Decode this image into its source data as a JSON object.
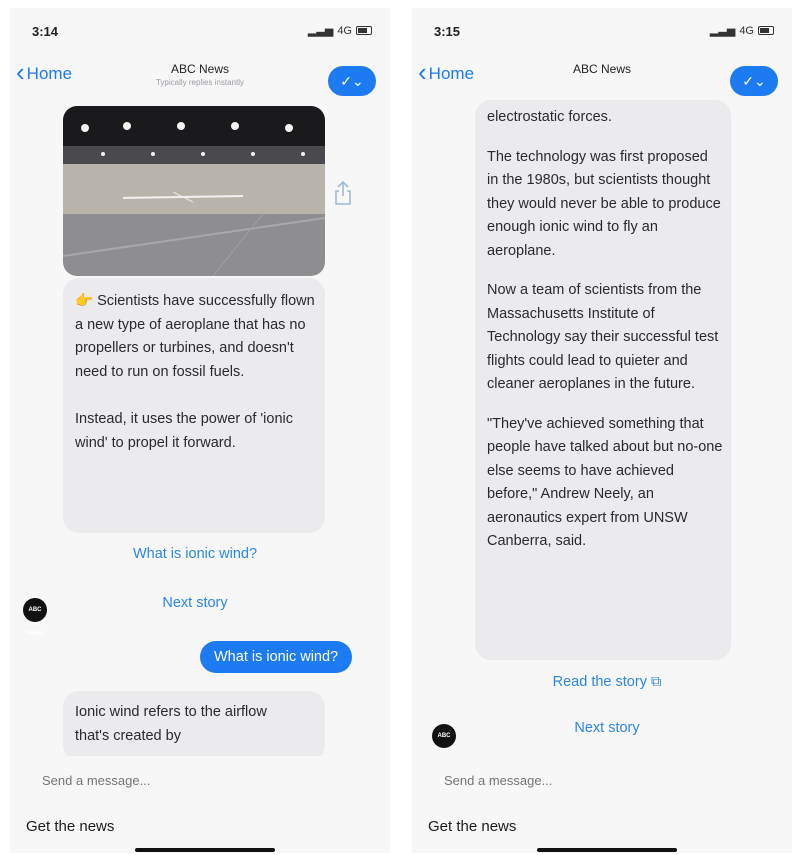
{
  "left": {
    "status_time": "3:14",
    "status_network": "4G",
    "nav": {
      "back_label": "Home",
      "title": "ABC News",
      "subtitle": "Typically replies instantly",
      "action_icon": "check-chevron-icon"
    },
    "image_alt": "Aircraft in an indoor hangar",
    "message_lead_emoji": "👉",
    "message_paragraphs": [
      "Scientists have successfully flown a new type of aeroplane that has no propellers or turbines, and doesn't need to run on fossil fuels.",
      "Instead, it uses the power of 'ionic wind' to propel it forward."
    ],
    "quick_replies": [
      "What is ionic wind?",
      "Next story"
    ],
    "user_message": "What is ionic wind?",
    "reply_partial": "Ionic wind refers to the airflow that's created by",
    "avatar_label": "ABC NEWS",
    "composer_placeholder": "Send a message...",
    "bottom_label": "Get the news"
  },
  "right": {
    "status_time": "3:15",
    "status_network": "4G",
    "nav": {
      "back_label": "Home",
      "title": "ABC News",
      "subtitle": "",
      "action_icon": "check-chevron-icon"
    },
    "message_paragraphs": [
      "electrostatic forces.",
      "The technology was first proposed in the 1980s, but scientists thought they would never be able to produce enough ionic wind to fly an aeroplane.",
      "Now a team of scientists from the Massachusetts Institute of Technology say their successful test flights could lead to quieter and cleaner aeroplanes in the future.",
      "\"They've achieved something that people have talked about but no-one else seems to have achieved before,\" Andrew Neely, an aeronautics expert from UNSW Canberra, said."
    ],
    "quick_replies": [
      "Read the story",
      "Next story"
    ],
    "avatar_label": "ABC NEWS",
    "composer_placeholder": "Send a message...",
    "bottom_label": "Get the news"
  },
  "colors": {
    "accent": "#1d7bf2",
    "link": "#2b86ea",
    "bubble": "#ebebed",
    "background": "#f7f7f8"
  }
}
